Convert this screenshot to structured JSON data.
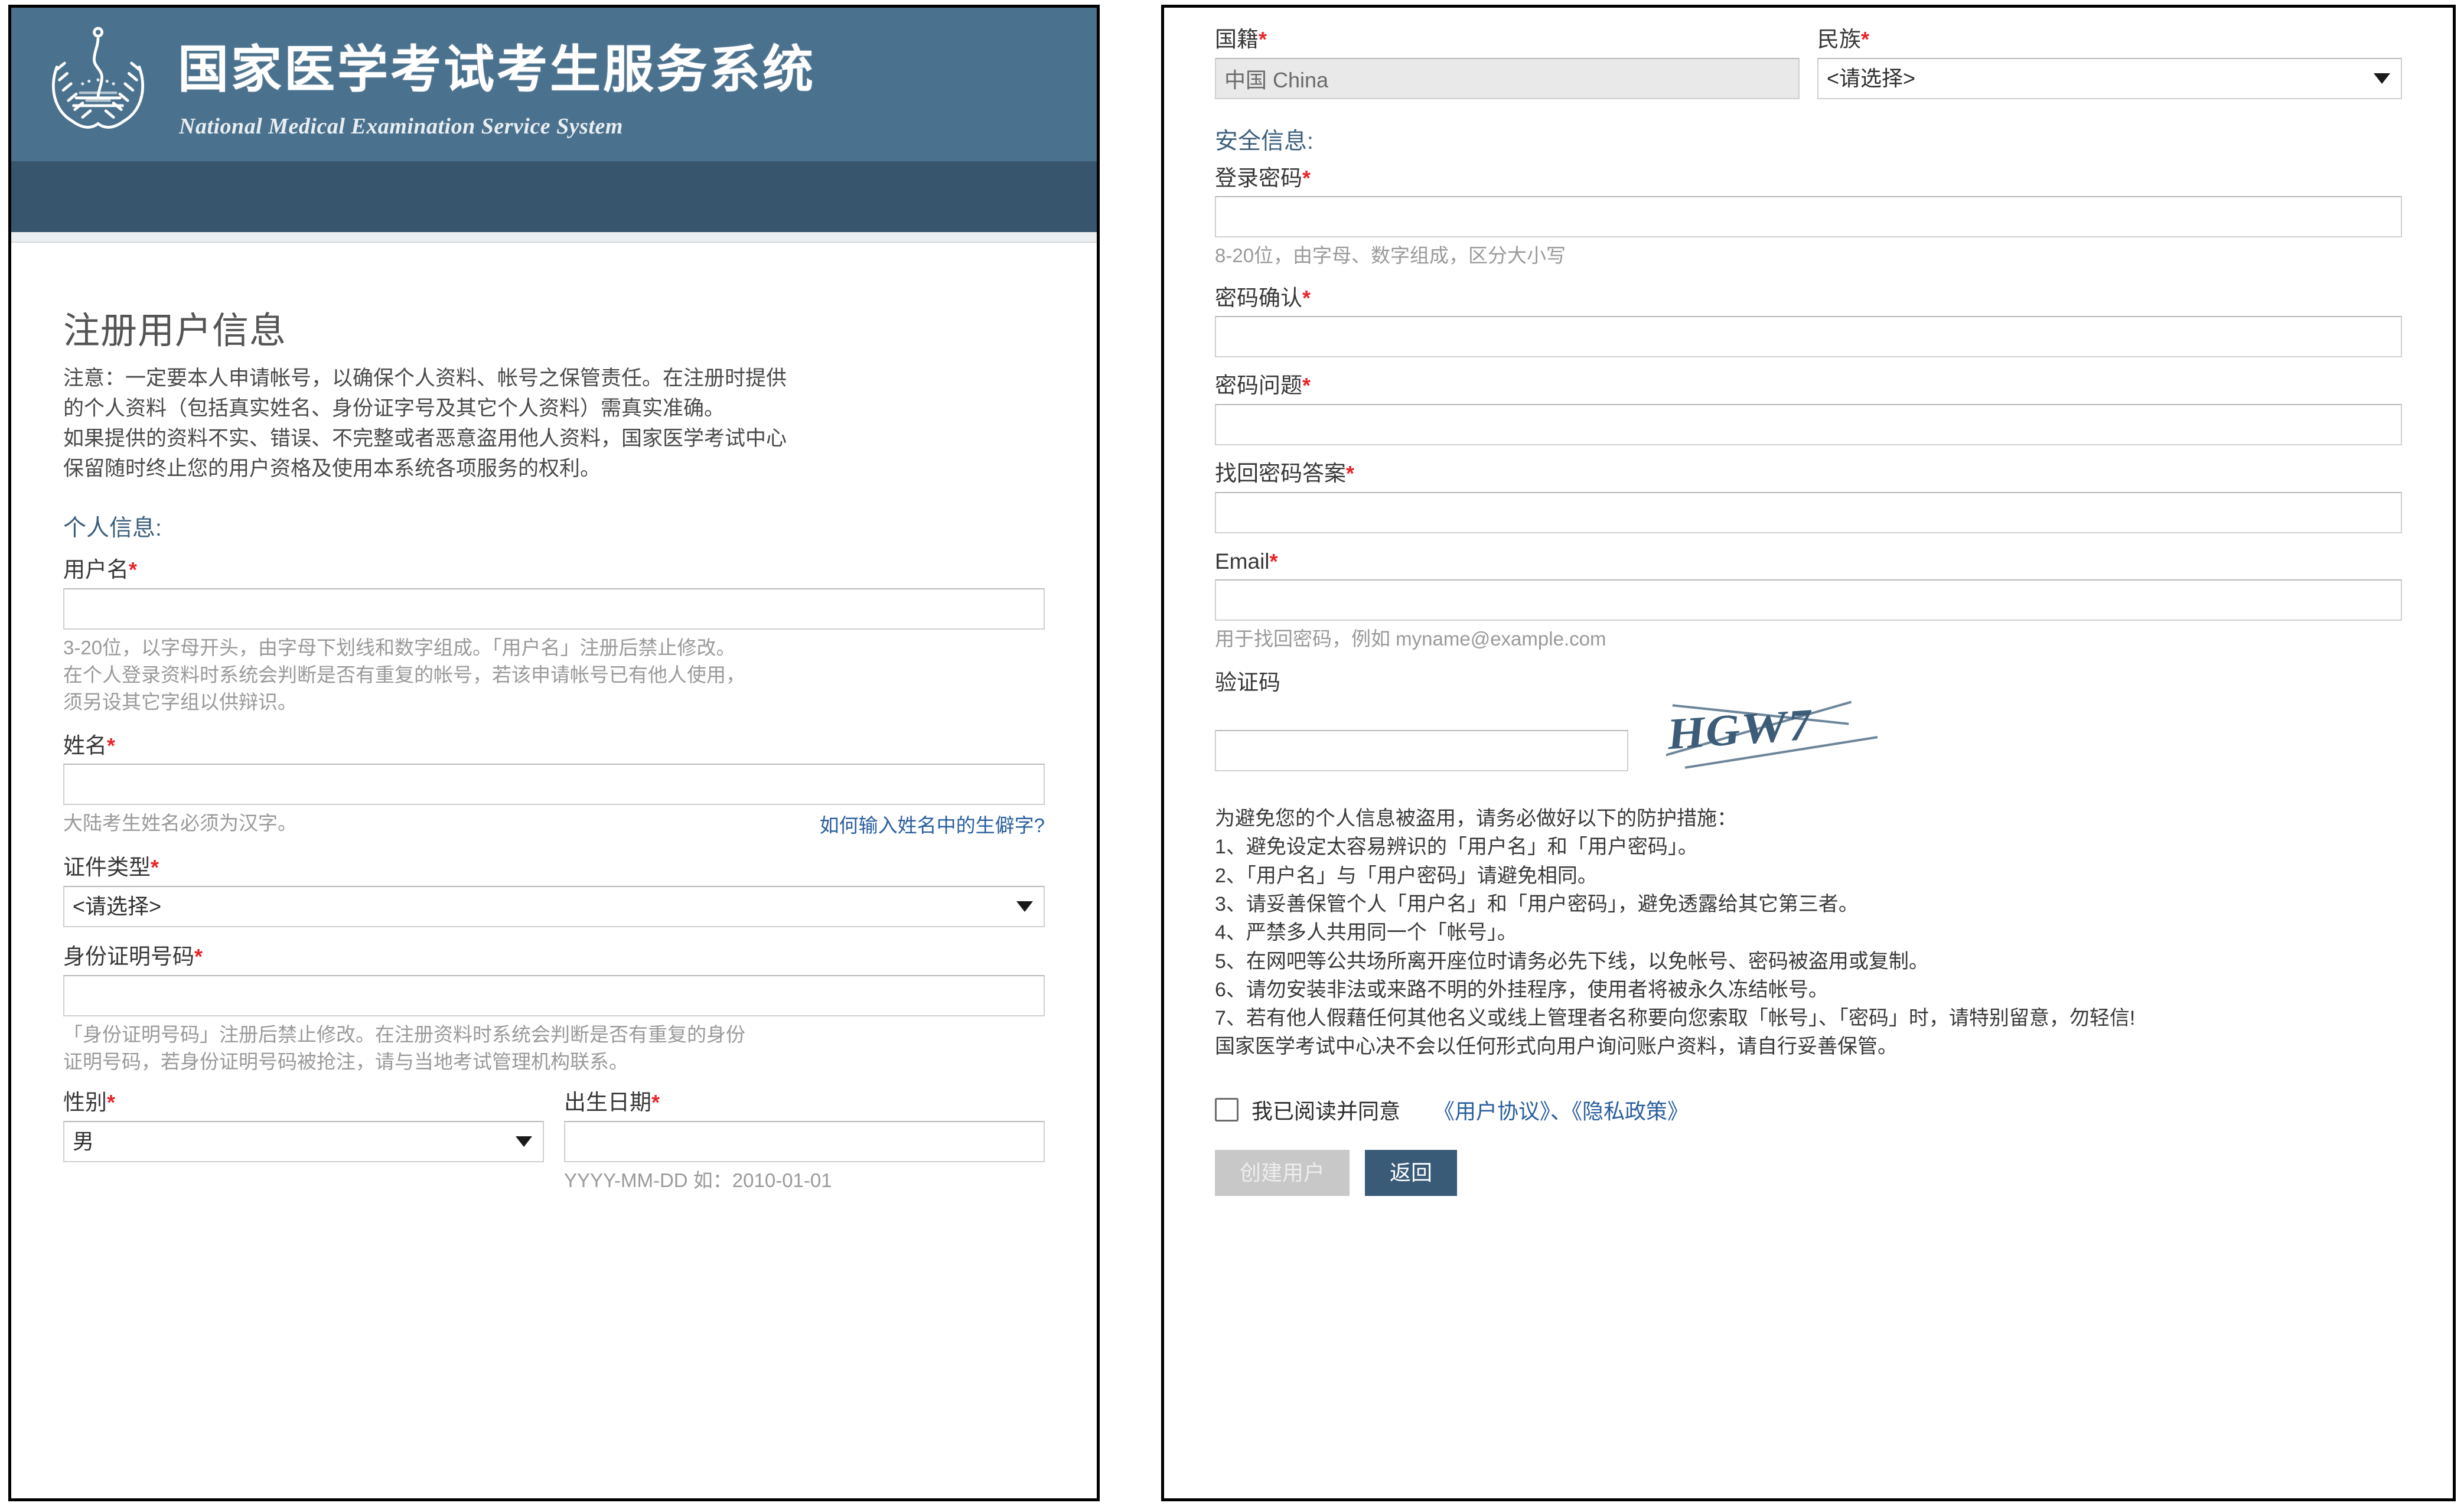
{
  "brand": {
    "title_cn": "国家医学考试考生服务系统",
    "title_en": "National Medical Examination Service System",
    "logo_icon": "laurel-wreath-caduceus-emblem",
    "banner_color_top": "#4a718d",
    "banner_color_bottom": "#37566e"
  },
  "left": {
    "page_title": "注册用户信息",
    "notice_lines": [
      "注意：一定要本人申请帐号，以确保个人资料、帐号之保管责任。在注册时提供",
      "的个人资料（包括真实姓名、身份证字号及其它个人资料）需真实准确。",
      "如果提供的资料不实、错误、不完整或者恶意盗用他人资料，国家医学考试中心",
      "保留随时终止您的用户资格及使用本系统各项服务的权利。"
    ],
    "section_personal": "个人信息:",
    "username": {
      "label": "用户名",
      "required": "*",
      "value": "",
      "hint_lines": [
        "3-20位，以字母开头，由字母下划线和数字组成。「用户名」注册后禁止修改。",
        "在个人登录资料时系统会判断是否有重复的帐号，若该申请帐号已有他人使用，",
        "须另设其它字组以供辩识。"
      ]
    },
    "realname": {
      "label": "姓名",
      "required": "*",
      "value": "",
      "hint": "大陆考生姓名必须为汉字。",
      "link": "如何输入姓名中的生僻字?"
    },
    "id_type": {
      "label": "证件类型",
      "required": "*",
      "value": "<请选择>"
    },
    "id_number": {
      "label": "身份证明号码",
      "required": "*",
      "value": "",
      "hint_lines": [
        "「身份证明号码」注册后禁止修改。在注册资料时系统会判断是否有重复的身份",
        "证明号码，若身份证明号码被抢注，请与当地考试管理机构联系。"
      ]
    },
    "gender": {
      "label": "性别",
      "required": "*",
      "value": "男"
    },
    "birthdate": {
      "label": "出生日期",
      "required": "*",
      "value": "",
      "hint": "YYYY-MM-DD 如：2010-01-01"
    }
  },
  "right": {
    "nationality": {
      "label": "国籍",
      "required": "*",
      "value": "中国 China"
    },
    "ethnicity": {
      "label": "民族",
      "required": "*",
      "value": "<请选择>"
    },
    "section_security": "安全信息:",
    "password": {
      "label": "登录密码",
      "required": "*",
      "value": "",
      "hint": "8-20位，由字母、数字组成，区分大小写"
    },
    "password_confirm": {
      "label": "密码确认",
      "required": "*",
      "value": ""
    },
    "password_question": {
      "label": "密码问题",
      "required": "*",
      "value": ""
    },
    "password_answer": {
      "label": "找回密码答案",
      "required": "*",
      "value": ""
    },
    "email": {
      "label": "Email",
      "required": "*",
      "value": "",
      "hint": "用于找回密码，例如 myname@example.com"
    },
    "captcha": {
      "label": "验证码",
      "value": "",
      "image_text": "HGW7"
    },
    "tips_heading": "为避免您的个人信息被盗用，请务必做好以下的防护措施：",
    "tips": [
      "1、避免设定太容易辨识的「用户名」和「用户密码」。",
      "2、「用户名」与「用户密码」请避免相同。",
      "3、请妥善保管个人「用户名」和「用户密码」，避免透露给其它第三者。",
      "4、严禁多人共用同一个「帐号」。",
      "5、在网吧等公共场所离开座位时请务必先下线，以免帐号、密码被盗用或复制。",
      "6、请勿安装非法或来路不明的外挂程序，使用者将被永久冻结帐号。",
      "7、若有他人假藉任何其他名义或线上管理者名称要向您索取「帐号」、「密码」时，请特别留意，勿轻信!",
      "国家医学考试中心决不会以任何形式向用户询问账户资料，请自行妥善保管。"
    ],
    "agree_text": "我已阅读并同意",
    "agree_link_user": "《用户协议》",
    "agree_sep": "、",
    "agree_link_privacy": "《隐私政策》",
    "btn_create": "创建用户",
    "btn_back": "返回",
    "link_color": "#2a5f9e",
    "primary_color": "#3a5b77"
  }
}
